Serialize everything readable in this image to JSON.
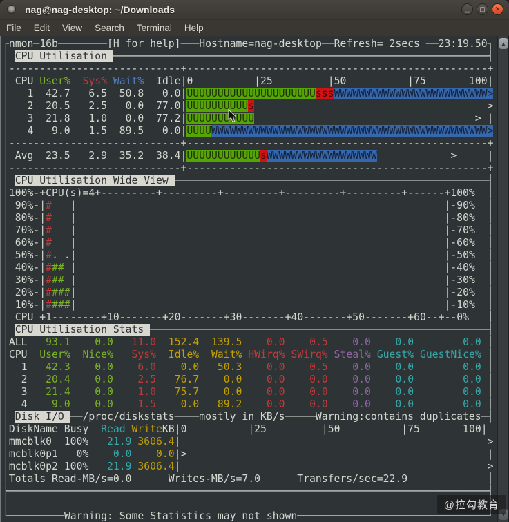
{
  "window": {
    "title": "nag@nag-desktop: ~/Downloads",
    "buttons": [
      {
        "name": "minimize",
        "glyph": "▁"
      },
      {
        "name": "maximize",
        "glyph": "▢"
      },
      {
        "name": "close",
        "glyph": "✕"
      }
    ]
  },
  "menu": {
    "items": [
      "File",
      "Edit",
      "View",
      "Search",
      "Terminal",
      "Help"
    ]
  },
  "watermark": "@拉勾教育",
  "colors": {
    "terminal_bg": "#2e3436",
    "terminal_fg": "#d3d7cf",
    "user_green": "#56a405",
    "sys_red": "#cc1414",
    "wait_blue": "#3767ab",
    "idle_yellow": "#c4a000",
    "guest_cyan": "#35a8a8",
    "steal_purple": "#8d66a0",
    "section_highlight": "#d8d8d0",
    "close_button": "#e2502f"
  },
  "terminal": {
    "lines": [
      [
        [
          "┌nmon─16b",
          "fg"
        ],
        [
          "─",
          "fg",
          8
        ],
        [
          "[H for help]",
          "fg"
        ],
        [
          "─",
          "fg",
          3
        ],
        [
          "Hostname=nag-desktop",
          "fg"
        ],
        [
          "─",
          "fg",
          2
        ],
        [
          "Refresh= 2secs ",
          "fg"
        ],
        [
          "─",
          "fg",
          2
        ],
        [
          "23:19.50",
          "fg"
        ],
        [
          "┐",
          "fg"
        ]
      ],
      [
        [
          "│ ",
          "fg"
        ],
        [
          "CPU Utilisation ",
          "hl"
        ],
        [
          "─",
          "fg",
          61
        ],
        [
          "┤",
          "fg"
        ]
      ],
      [
        [
          "│",
          "fg"
        ],
        [
          "-",
          "fg",
          28
        ],
        [
          "+",
          "fg"
        ],
        [
          "-",
          "fg",
          49
        ],
        [
          "+",
          "fg"
        ]
      ],
      [
        [
          "│ CPU ",
          "fg"
        ],
        [
          "User%",
          "grn"
        ],
        [
          "  ",
          "fg"
        ],
        [
          "Sys%",
          "red"
        ],
        [
          " ",
          "fg"
        ],
        [
          "Wait%",
          "blu"
        ],
        [
          "  Idle",
          "fg"
        ],
        [
          "|0          |25         |50          |75       100|",
          "fg"
        ]
      ],
      [
        [
          "│   1  42.7   6.5  50.8   0.0|",
          "fg"
        ],
        [
          "U",
          "bgU",
          21
        ],
        [
          "sss",
          "bgS"
        ],
        [
          "W",
          "bgW",
          25
        ],
        [
          ">",
          "bgW"
        ]
      ],
      [
        [
          "│   2  20.5   2.5   0.0  77.0|",
          "fg"
        ],
        [
          "U",
          "bgU",
          10
        ],
        [
          "s",
          "bgS"
        ],
        [
          " ",
          "fg",
          38
        ],
        [
          ">",
          "fg"
        ]
      ],
      [
        [
          "│   3  21.8   1.0   0.0  77.2|",
          "fg"
        ],
        [
          "U",
          "bgU",
          11
        ],
        [
          " ",
          "fg",
          36
        ],
        [
          "> |",
          "fg"
        ]
      ],
      [
        [
          "│   4   9.0   1.5  89.5   0.0|",
          "fg"
        ],
        [
          "U",
          "bgU",
          4
        ],
        [
          "W",
          "bgW",
          45
        ],
        [
          ">",
          "bgW"
        ]
      ],
      [
        [
          "│",
          "fg"
        ],
        [
          "-",
          "fg",
          28
        ],
        [
          "+",
          "fg"
        ],
        [
          "-",
          "fg",
          49
        ],
        [
          "+",
          "fg"
        ]
      ],
      [
        [
          "│ Avg  23.5   2.9  35.2  38.4|",
          "fg"
        ],
        [
          "U",
          "bgU",
          12
        ],
        [
          "s",
          "bgS"
        ],
        [
          "W",
          "bgW",
          18
        ],
        [
          " ",
          "fg",
          12
        ],
        [
          ">",
          "fg"
        ],
        [
          " ",
          "fg",
          5
        ],
        [
          "|",
          "fg"
        ]
      ],
      [
        [
          "│",
          "fg"
        ],
        [
          "-",
          "fg",
          28
        ],
        [
          "+",
          "fg"
        ],
        [
          "-",
          "fg",
          49
        ],
        [
          "+",
          "fg"
        ]
      ],
      [
        [
          "│ ",
          "fg"
        ],
        [
          "CPU Utilisation Wide View ",
          "hl"
        ],
        [
          "─",
          "fg",
          51
        ],
        [
          "┤",
          "fg"
        ]
      ],
      [
        [
          "│100%-+CPU(s)=4+",
          "fg"
        ],
        [
          "---------+",
          "fg",
          5
        ],
        [
          "------",
          "fg"
        ],
        [
          "+100%",
          "fg"
        ],
        [
          "  │",
          "fg"
        ]
      ],
      [
        [
          "│ 90%-|",
          "fg"
        ],
        [
          "#",
          "red"
        ],
        [
          "   |",
          "fg"
        ],
        [
          " ",
          "fg",
          60
        ],
        [
          "|-90%  │",
          "fg"
        ]
      ],
      [
        [
          "│ 80%-|",
          "fg"
        ],
        [
          "#",
          "red"
        ],
        [
          "   |",
          "fg"
        ],
        [
          " ",
          "fg",
          60
        ],
        [
          "|-80%  │",
          "fg"
        ]
      ],
      [
        [
          "│ 70%-|",
          "fg"
        ],
        [
          "#",
          "red"
        ],
        [
          "   |",
          "fg"
        ],
        [
          " ",
          "fg",
          60
        ],
        [
          "|-70%  │",
          "fg"
        ]
      ],
      [
        [
          "│ 60%-|",
          "fg"
        ],
        [
          "#",
          "red"
        ],
        [
          "   |",
          "fg"
        ],
        [
          " ",
          "fg",
          60
        ],
        [
          "|-60%  │",
          "fg"
        ]
      ],
      [
        [
          "│ 50%-|",
          "fg"
        ],
        [
          "#",
          "red"
        ],
        [
          ". .",
          "fg"
        ],
        [
          "|",
          "fg"
        ],
        [
          " ",
          "fg",
          60
        ],
        [
          "|-50%  │",
          "fg"
        ]
      ],
      [
        [
          "│ 40%-|",
          "fg"
        ],
        [
          "#",
          "red"
        ],
        [
          "##",
          "grn"
        ],
        [
          " |",
          "fg"
        ],
        [
          " ",
          "fg",
          60
        ],
        [
          "|-40%  │",
          "fg"
        ]
      ],
      [
        [
          "│ 30%-|",
          "fg"
        ],
        [
          "#",
          "red"
        ],
        [
          "##",
          "grn"
        ],
        [
          " |",
          "fg"
        ],
        [
          " ",
          "fg",
          60
        ],
        [
          "|-30%  │",
          "fg"
        ]
      ],
      [
        [
          "│ 20%-|",
          "fg"
        ],
        [
          "#",
          "red"
        ],
        [
          "###",
          "grn"
        ],
        [
          "|",
          "fg"
        ],
        [
          " ",
          "fg",
          60
        ],
        [
          "|-20%  │",
          "fg"
        ]
      ],
      [
        [
          "│ 10%-|",
          "fg"
        ],
        [
          "#",
          "red"
        ],
        [
          "###",
          "grn"
        ],
        [
          "|",
          "fg"
        ],
        [
          " ",
          "fg",
          60
        ],
        [
          "|-10%  │",
          "fg"
        ]
      ],
      [
        [
          "│ CPU +1",
          "fg"
        ],
        [
          "-",
          "fg",
          8
        ],
        [
          "+10",
          "fg"
        ],
        [
          "-",
          "fg",
          7
        ],
        [
          "+20",
          "fg"
        ],
        [
          "-",
          "fg",
          7
        ],
        [
          "+30",
          "fg"
        ],
        [
          "-",
          "fg",
          7
        ],
        [
          "+40",
          "fg"
        ],
        [
          "-",
          "fg",
          7
        ],
        [
          "+50",
          "fg"
        ],
        [
          "-",
          "fg",
          7
        ],
        [
          "+60",
          "fg"
        ],
        [
          "--+--0%",
          "fg"
        ],
        [
          "   │",
          "fg"
        ]
      ],
      [
        [
          "│ ",
          "fg"
        ],
        [
          "CPU Utilisation Stats ",
          "hl"
        ],
        [
          "─",
          "fg",
          55
        ],
        [
          "┤",
          "fg"
        ]
      ],
      [
        [
          "│ALL",
          "fg"
        ],
        [
          "   93.1",
          "grn"
        ],
        [
          "    0.0",
          "grn"
        ],
        [
          "   11.0",
          "red"
        ],
        [
          "  152.4",
          "yel"
        ],
        [
          "  139.5",
          "yel"
        ],
        [
          "    0.0",
          "red"
        ],
        [
          "    0.5",
          "red"
        ],
        [
          "    0.0",
          "pur"
        ],
        [
          "    0.0",
          "cyn"
        ],
        [
          "        0.0",
          "cyn"
        ],
        [
          " │",
          "fg"
        ]
      ],
      [
        [
          "│CPU",
          "fg"
        ],
        [
          "  User%",
          "grn"
        ],
        [
          "  Nice%",
          "grn"
        ],
        [
          "   Sys%",
          "red"
        ],
        [
          "  Idle%",
          "yel"
        ],
        [
          "  Wait%",
          "yel"
        ],
        [
          " HWirq%",
          "red"
        ],
        [
          " SWirq%",
          "red"
        ],
        [
          " Steal%",
          "pur"
        ],
        [
          " Guest%",
          "cyn"
        ],
        [
          " GuestNice%",
          "cyn"
        ],
        [
          " │",
          "fg"
        ]
      ],
      [
        [
          "│  1",
          "fg"
        ],
        [
          "   42.3",
          "grn"
        ],
        [
          "    0.0",
          "grn"
        ],
        [
          "    6.0",
          "red"
        ],
        [
          "    0.0",
          "yel"
        ],
        [
          "   50.3",
          "yel"
        ],
        [
          "    0.0",
          "red"
        ],
        [
          "    0.5",
          "red"
        ],
        [
          "    0.0",
          "pur"
        ],
        [
          "    0.0",
          "cyn"
        ],
        [
          "        0.0",
          "cyn"
        ],
        [
          " │",
          "fg"
        ]
      ],
      [
        [
          "│  2",
          "fg"
        ],
        [
          "   20.4",
          "grn"
        ],
        [
          "    0.0",
          "grn"
        ],
        [
          "    2.5",
          "red"
        ],
        [
          "   76.7",
          "yel"
        ],
        [
          "    0.0",
          "yel"
        ],
        [
          "    0.0",
          "red"
        ],
        [
          "    0.0",
          "red"
        ],
        [
          "    0.0",
          "pur"
        ],
        [
          "    0.0",
          "cyn"
        ],
        [
          "        0.0",
          "cyn"
        ],
        [
          " │",
          "fg"
        ]
      ],
      [
        [
          "│  3",
          "fg"
        ],
        [
          "   21.4",
          "grn"
        ],
        [
          "    0.0",
          "grn"
        ],
        [
          "    1.0",
          "red"
        ],
        [
          "   75.7",
          "yel"
        ],
        [
          "    0.0",
          "yel"
        ],
        [
          "    0.0",
          "red"
        ],
        [
          "    0.0",
          "red"
        ],
        [
          "    0.0",
          "pur"
        ],
        [
          "    0.0",
          "cyn"
        ],
        [
          "        0.0",
          "cyn"
        ],
        [
          " │",
          "fg"
        ]
      ],
      [
        [
          "│  4",
          "fg"
        ],
        [
          "    9.0",
          "grn"
        ],
        [
          "    0.0",
          "grn"
        ],
        [
          "    1.5",
          "red"
        ],
        [
          "    0.0",
          "yel"
        ],
        [
          "   89.2",
          "yel"
        ],
        [
          "    0.0",
          "red"
        ],
        [
          "    0.0",
          "red"
        ],
        [
          "    0.0",
          "pur"
        ],
        [
          "    0.0",
          "cyn"
        ],
        [
          "        0.0",
          "cyn"
        ],
        [
          " │",
          "fg"
        ]
      ],
      [
        [
          "│ ",
          "fg"
        ],
        [
          "Disk I/O ",
          "hl"
        ],
        [
          "──/proc/diskstats────mostly in KB/s─────Warning:contains duplicates─",
          "fg"
        ],
        [
          "┤",
          "fg"
        ]
      ],
      [
        [
          "│DiskName Busy  ",
          "fg"
        ],
        [
          "Read",
          "cyn"
        ],
        [
          " ",
          "fg"
        ],
        [
          "Write",
          "yel"
        ],
        [
          "KB",
          "fg"
        ],
        [
          "|0          |25         |50          |75       100|",
          "fg"
        ]
      ],
      [
        [
          "│mmcblk0  100%",
          "fg"
        ],
        [
          "   21.9",
          "cyn"
        ],
        [
          " 3606.4",
          "yel"
        ],
        [
          "|",
          "fg"
        ],
        [
          " ",
          "fg",
          50
        ],
        [
          ">",
          "fg"
        ]
      ],
      [
        [
          "│mcblk0p1   0%",
          "fg"
        ],
        [
          "    0.0",
          "cyn"
        ],
        [
          "    0.0",
          "yel"
        ],
        [
          "|>",
          "fg"
        ],
        [
          " ",
          "fg",
          49
        ],
        [
          "|",
          "fg"
        ]
      ],
      [
        [
          "│mcblk0p2 100%",
          "fg"
        ],
        [
          "   21.9",
          "cyn"
        ],
        [
          " 3606.4",
          "yel"
        ],
        [
          "|",
          "fg"
        ],
        [
          " ",
          "fg",
          50
        ],
        [
          ">",
          "fg"
        ]
      ],
      [
        [
          "│Totals Read-MB/s=0.0      Writes-MB/s=7.0      Transfers/sec=22.9",
          "fg"
        ],
        [
          " ",
          "fg",
          13
        ],
        [
          "│",
          "fg"
        ]
      ],
      [
        [
          "├",
          "fg"
        ],
        [
          "─",
          "fg",
          78
        ],
        [
          "┤",
          "fg"
        ]
      ],
      [
        [
          "│",
          "fg"
        ],
        [
          " ",
          "fg",
          78
        ],
        [
          "│",
          "fg"
        ]
      ],
      [
        [
          "└",
          "fg"
        ],
        [
          "─",
          "fg",
          9
        ],
        [
          "Warning: Some Statistics may not shown",
          "fg"
        ],
        [
          "─",
          "fg",
          31
        ],
        [
          "┘",
          "fg"
        ]
      ]
    ]
  }
}
